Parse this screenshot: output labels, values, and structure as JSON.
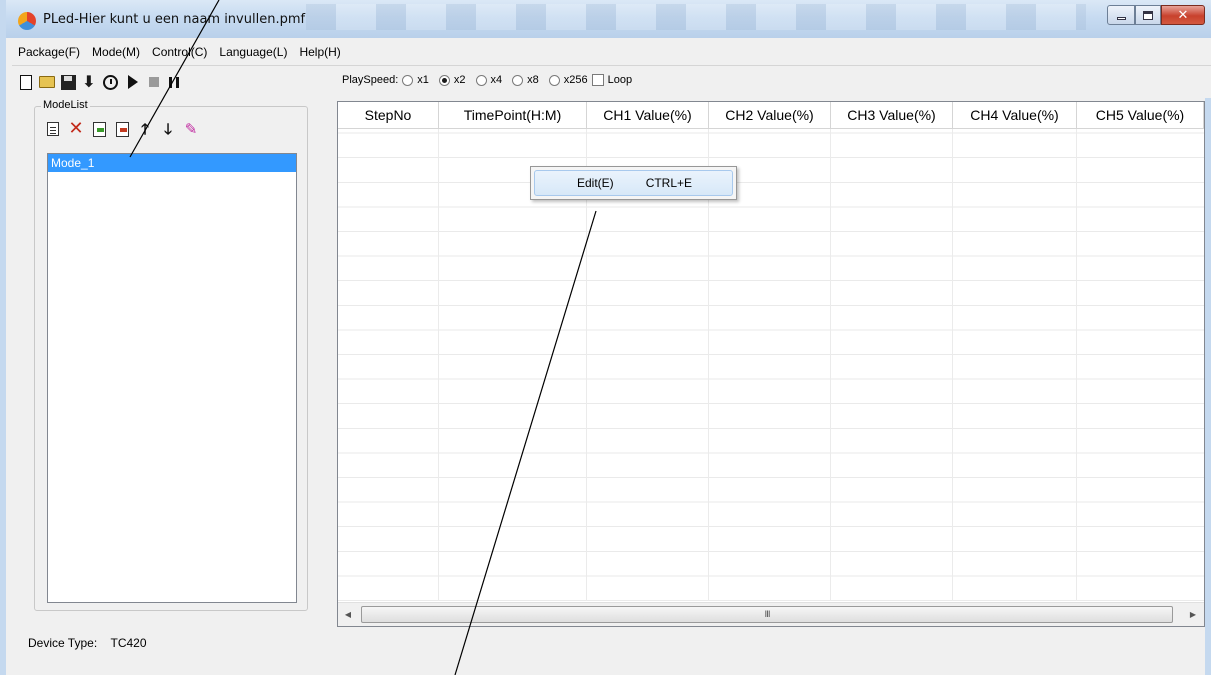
{
  "window": {
    "title": "PLed-Hier kunt u een naam invullen.pmf"
  },
  "menubar": {
    "items": [
      "Package(F)",
      "Mode(M)",
      "Control(C)",
      "Language(L)",
      "Help(H)"
    ]
  },
  "toolbar": {
    "icons": [
      "new-file-icon",
      "open-folder-icon",
      "save-icon",
      "download-icon",
      "clock-icon",
      "play-icon",
      "stop-icon",
      "pause-icon"
    ],
    "playspeed_label": "PlaySpeed:",
    "speeds": [
      {
        "label": "x1",
        "checked": false
      },
      {
        "label": "x2",
        "checked": true
      },
      {
        "label": "x4",
        "checked": false
      },
      {
        "label": "x8",
        "checked": false
      },
      {
        "label": "x256",
        "checked": false
      }
    ],
    "loop_label": "Loop",
    "loop_checked": false
  },
  "modelist": {
    "legend": "ModeList",
    "tool_icons": [
      "add-mode-icon",
      "delete-mode-icon",
      "import-mode-icon",
      "export-mode-icon",
      "move-up-icon",
      "move-down-icon",
      "rename-mode-icon"
    ],
    "items": [
      "Mode_1"
    ],
    "selected_index": 0
  },
  "grid": {
    "columns": [
      "StepNo",
      "TimePoint(H:M)",
      "CH1 Value(%)",
      "CH2 Value(%)",
      "CH3 Value(%)",
      "CH4 Value(%)",
      "CH5 Value(%)"
    ],
    "rows": [],
    "scroll_grip": "III"
  },
  "context_menu": {
    "items": [
      {
        "label": "Edit(E)",
        "shortcut": "CTRL+E"
      }
    ]
  },
  "status": {
    "device_type_label": "Device Type:",
    "device_type_value": "TC420"
  },
  "colors": {
    "selection": "#3399ff",
    "menu_hover": "#d7e8f8",
    "close_button": "#c8412d"
  }
}
